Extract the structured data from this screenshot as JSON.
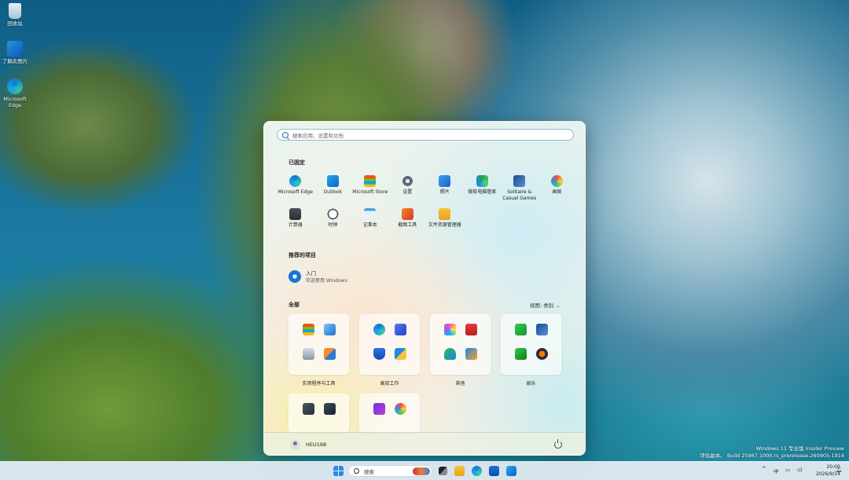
{
  "desktop": {
    "icons": [
      {
        "label": "回收站"
      },
      {
        "label": "了解此图片"
      },
      {
        "label": "Microsoft Edge"
      }
    ],
    "watermark": {
      "line1": "Windows 11 专业版 Insider Preview",
      "line2": "评估副本。 Build 25967.1000.rs_prerelease.260905-1914"
    }
  },
  "start_menu": {
    "search_placeholder": "搜索应用、设置和文档",
    "pinned_title": "已固定",
    "pinned": [
      {
        "label": "Microsoft Edge",
        "icon": "edge-icon"
      },
      {
        "label": "Outlook",
        "icon": "outlook-icon"
      },
      {
        "label": "Microsoft Store",
        "icon": "store-icon"
      },
      {
        "label": "设置",
        "icon": "settings-icon"
      },
      {
        "label": "照片",
        "icon": "photos-icon"
      },
      {
        "label": "微软电脑管家",
        "icon": "pc-manager-icon"
      },
      {
        "label": "Solitaire & Casual Games",
        "icon": "solitaire-icon"
      },
      {
        "label": "画图",
        "icon": "paint-icon"
      },
      {
        "label": "计算器",
        "icon": "calculator-icon"
      },
      {
        "label": "时钟",
        "icon": "clock-icon"
      },
      {
        "label": "记事本",
        "icon": "notepad-icon"
      },
      {
        "label": "截图工具",
        "icon": "snipping-tool-icon"
      },
      {
        "label": "文件资源管理器",
        "icon": "file-explorer-icon"
      }
    ],
    "recommended_title": "推荐的项目",
    "recommended": {
      "name": "入门",
      "subtitle": "欢迎使用 Windows"
    },
    "all_title": "全部",
    "view_toggle": "视图: 类别",
    "categories": [
      {
        "label": "实用程序与工具"
      },
      {
        "label": "高效工作"
      },
      {
        "label": "其他"
      },
      {
        "label": "娱乐"
      }
    ],
    "user_name": "HEU168"
  },
  "taskbar": {
    "search_label": "搜索",
    "tray": {
      "ime": "中",
      "time": "20:00",
      "date": "2026/9/14"
    }
  }
}
